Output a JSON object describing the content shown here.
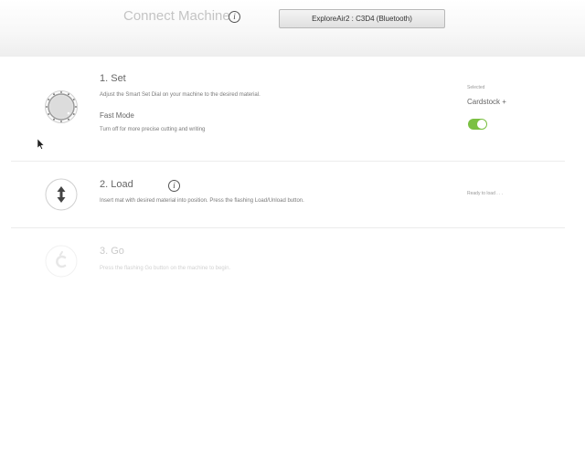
{
  "header": {
    "title": "Connect Machine",
    "machine_select": "ExploreAir2 : C3D4 (Bluetooth)"
  },
  "steps": {
    "set": {
      "title": "1. Set",
      "description": "Adjust the Smart Set Dial on your machine to the desired material.",
      "fast_mode_label": "Fast Mode",
      "fast_mode_description": "Turn off for more precise cutting and writing",
      "selected_label": "Selected",
      "selected_value": "Cardstock +",
      "fast_mode_on": true,
      "toggle_color": "#7bc043"
    },
    "load": {
      "title": "2. Load",
      "description": "Insert mat with desired material into position. Press the flashing Load/Unload button.",
      "status": "Ready to load . . ."
    },
    "go": {
      "title": "3. Go",
      "description": "Press the flashing Go button on the machine to begin."
    }
  },
  "icons": {
    "dial": "smart-set-dial-icon",
    "load": "load-unload-arrows-icon",
    "go": "cricut-go-icon",
    "info": "info-icon",
    "cursor": "mouse-pointer-icon"
  }
}
